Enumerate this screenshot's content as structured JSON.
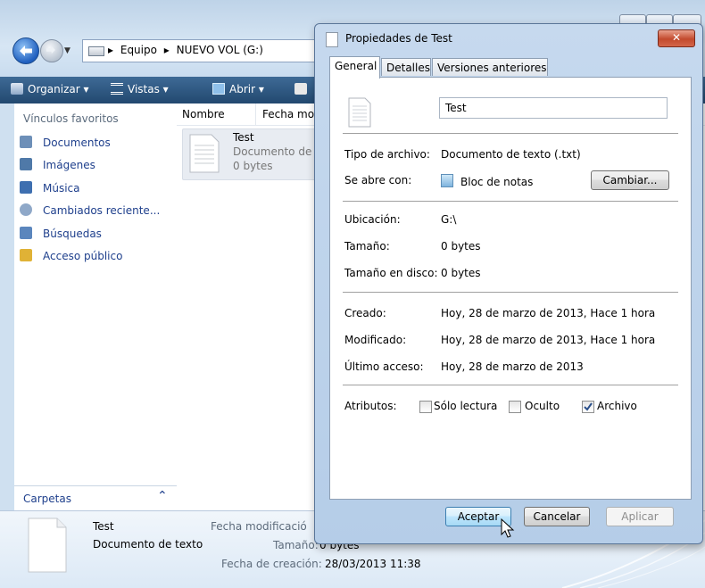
{
  "explorer": {
    "breadcrumb": [
      "Equipo",
      "NUEVO VOL (G:)"
    ],
    "toolbar": {
      "organizar": "Organizar",
      "vistas": "Vistas",
      "abrir": "Abrir"
    },
    "favorites_title": "Vínculos favoritos",
    "favorites": [
      {
        "label": "Documentos",
        "icon": "documents-icon",
        "color": "#6d8fb8"
      },
      {
        "label": "Imágenes",
        "icon": "pictures-icon",
        "color": "#4f79a8"
      },
      {
        "label": "Música",
        "icon": "music-icon",
        "color": "#3e6fb0"
      },
      {
        "label": "Cambiados reciente...",
        "icon": "recent-icon",
        "color": "#8fa8c8"
      },
      {
        "label": "Búsquedas",
        "icon": "search-folder-icon",
        "color": "#5b86bd"
      },
      {
        "label": "Acceso público",
        "icon": "public-folder-icon",
        "color": "#e0b236"
      }
    ],
    "carpetas": "Carpetas",
    "columns": {
      "nombre": "Nombre",
      "fecha": "Fecha mo"
    },
    "file": {
      "name": "Test",
      "type": "Documento de",
      "size": "0 bytes"
    },
    "details_pane": {
      "name": "Test",
      "type": "Documento de texto",
      "fecha_mod_label": "Fecha modificació",
      "tamano_label": "Tamaño:",
      "tamano_value": "0 bytes",
      "fecha_creacion_label": "Fecha de creación:",
      "fecha_creacion_value": "28/03/2013 11:38"
    }
  },
  "dialog": {
    "title": "Propiedades de Test",
    "close_symbol": "✕",
    "tabs": [
      "General",
      "Detalles",
      "Versiones anteriores"
    ],
    "active_tab": "General",
    "name_value": "Test",
    "tipo_label": "Tipo de archivo:",
    "tipo_value": "Documento de texto (.txt)",
    "abre_label": "Se abre con:",
    "abre_value": "Bloc de notas",
    "cambiar": "Cambiar...",
    "ubicacion_label": "Ubicación:",
    "ubicacion_value": "G:\\",
    "tamano_label": "Tamaño:",
    "tamano_value": "0 bytes",
    "tamano_disco_label": "Tamaño en disco:",
    "tamano_disco_value": "0 bytes",
    "creado_label": "Creado:",
    "creado_value": "Hoy, 28 de marzo de 2013, Hace 1 hora",
    "modificado_label": "Modificado:",
    "modificado_value": "Hoy, 28 de marzo de 2013, Hace 1 hora",
    "acceso_label": "Último acceso:",
    "acceso_value": "Hoy, 28 de marzo de 2013",
    "atributos_label": "Atributos:",
    "attr_solo_lectura": "Sólo lectura",
    "attr_oculto": "Oculto",
    "attr_archivo": "Archivo",
    "attr_checked": {
      "solo_lectura": false,
      "oculto": false,
      "archivo": true
    },
    "aceptar": "Aceptar",
    "cancelar": "Cancelar",
    "aplicar": "Aplicar"
  }
}
